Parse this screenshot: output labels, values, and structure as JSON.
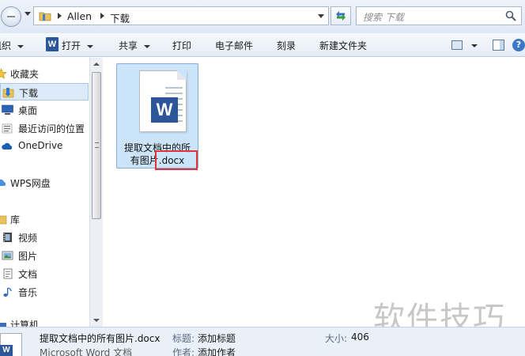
{
  "address": {
    "crumbs": [
      "Allen",
      "下载"
    ],
    "search_placeholder": "搜索 下载"
  },
  "toolbar": {
    "organize": "组织",
    "open": "打开",
    "share": "共享",
    "print": "打印",
    "email": "电子邮件",
    "burn": "刻录",
    "new_folder": "新建文件夹"
  },
  "nav": {
    "favorites": "收藏夹",
    "downloads": "下载",
    "desktop": "桌面",
    "recent": "最近访问的位置",
    "onedrive": "OneDrive",
    "wps": "WPS网盘",
    "libraries": "库",
    "videos": "视频",
    "pictures": "图片",
    "documents": "文档",
    "music": "音乐",
    "computer": "计算机"
  },
  "file": {
    "name_line1": "提取文档中的所",
    "name_line2_prefix": "有图片",
    "name_ext": ".docx"
  },
  "details": {
    "filename": "提取文档中的所有图片.docx",
    "filetype": "Microsoft Word 文档",
    "title_key": "标题:",
    "title_val": "添加标题",
    "author_key": "作者:",
    "author_val": "添加作者",
    "size_key": "大小:",
    "size_val": "406"
  },
  "watermark": "软件技巧",
  "colors": {
    "selection": "#cce4f8",
    "highlight_box": "#e0343a",
    "word_blue": "#2b579a"
  }
}
